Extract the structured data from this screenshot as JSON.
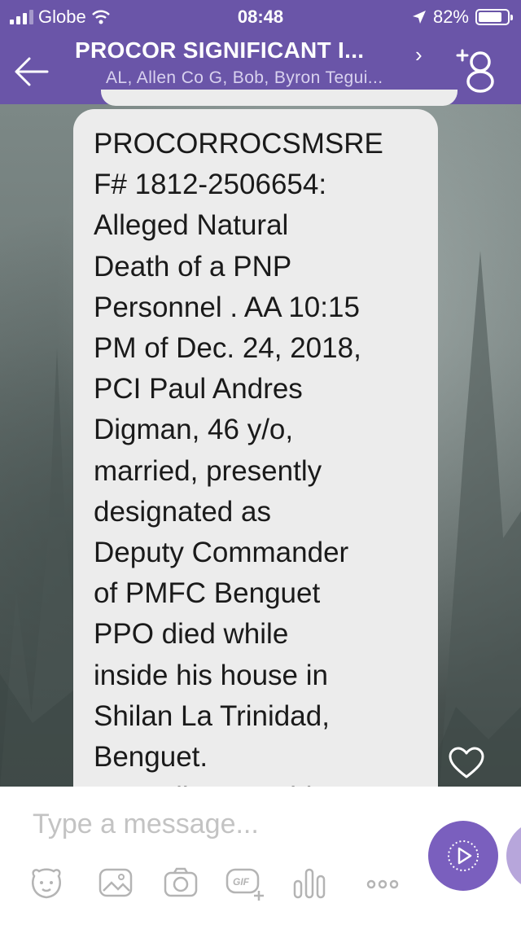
{
  "status_bar": {
    "carrier": "Globe",
    "time": "08:48",
    "battery_percent": "82%",
    "battery_level": 0.82,
    "signal_bars": 3,
    "signal_max": 4
  },
  "header": {
    "title": "PROCOR SIGNIFICANT I...",
    "chevron": "›",
    "members": "AL, Allen Co G, Bob, Byron Tegui...",
    "back_icon": "back-arrow-icon",
    "add_member_icon": "add-member-icon"
  },
  "message": {
    "text": "PROCORROCSMSRE\nF# 1812-2506654:\nAlleged Natural\nDeath of a PNP\nPersonnel  . AA 10:15\nPM of Dec. 24, 2018,\nPCI Paul Andres\nDigman, 46 y/o,\nmarried, presently\ndesignated as\nDeputy Commander\nof PMFC Benguet\nPPO died while\ninside his house in\nShilan La Trinidad,\nBenguet.\nAccording to said"
  },
  "composer": {
    "placeholder": "Type a message...",
    "tools": [
      "sticker-icon",
      "image-icon",
      "camera-icon",
      "gif-icon",
      "audio-icon",
      "more-icon"
    ],
    "gif_text": "GIF",
    "send_icon": "send-icon"
  },
  "colors": {
    "header": "#6a55a8",
    "accent": "#7a5fbe",
    "bubble": "#ececec"
  }
}
